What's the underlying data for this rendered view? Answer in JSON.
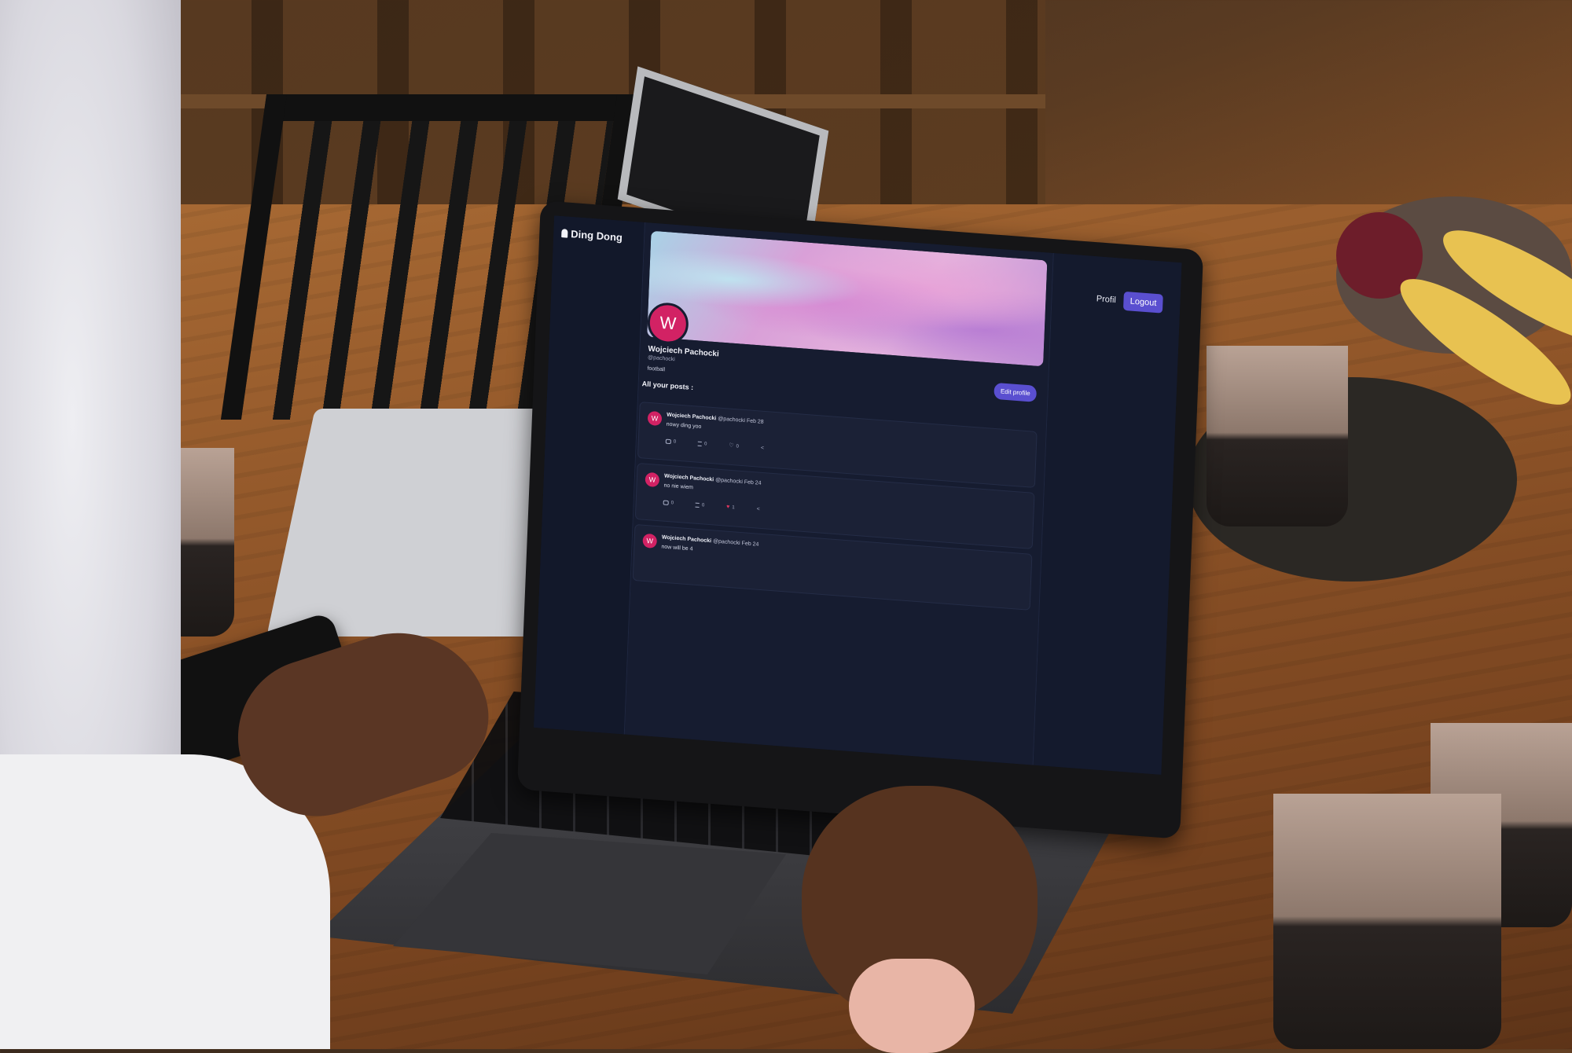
{
  "app": {
    "brand": "Ding Dong"
  },
  "nav": {
    "profil_label": "Profil",
    "logout_label": "Logout"
  },
  "profile": {
    "avatar_initial": "W",
    "name": "Wojciech Pachocki",
    "handle": "@pachocki",
    "bio": "football",
    "edit_label": "Edit profile"
  },
  "posts_heading": "All your posts :",
  "posts": [
    {
      "avatar_initial": "W",
      "author": "Wojciech Pachocki",
      "handle": "@pachocki",
      "date": "Feb 28",
      "text": "nowy ding yoo",
      "comments": "0",
      "reposts": "0",
      "likes": "0",
      "liked": false
    },
    {
      "avatar_initial": "W",
      "author": "Wojciech Pachocki",
      "handle": "@pachocki",
      "date": "Feb 24",
      "text": "no nie wiem",
      "comments": "0",
      "reposts": "0",
      "likes": "1",
      "liked": true
    },
    {
      "avatar_initial": "W",
      "author": "Wojciech Pachocki",
      "handle": "@pachocki",
      "date": "Feb 24",
      "text": "now will be 4",
      "comments": "",
      "reposts": "",
      "likes": "",
      "liked": false
    }
  ],
  "icons": {
    "brand": "bell-icon",
    "comment": "comment-icon",
    "repost": "repost-icon",
    "like": "heart-icon",
    "share": "share-icon"
  },
  "colors": {
    "accent": "#5a4fd0",
    "avatar": "#d22264",
    "background": "#141a2d",
    "liked": "#e0355f"
  }
}
